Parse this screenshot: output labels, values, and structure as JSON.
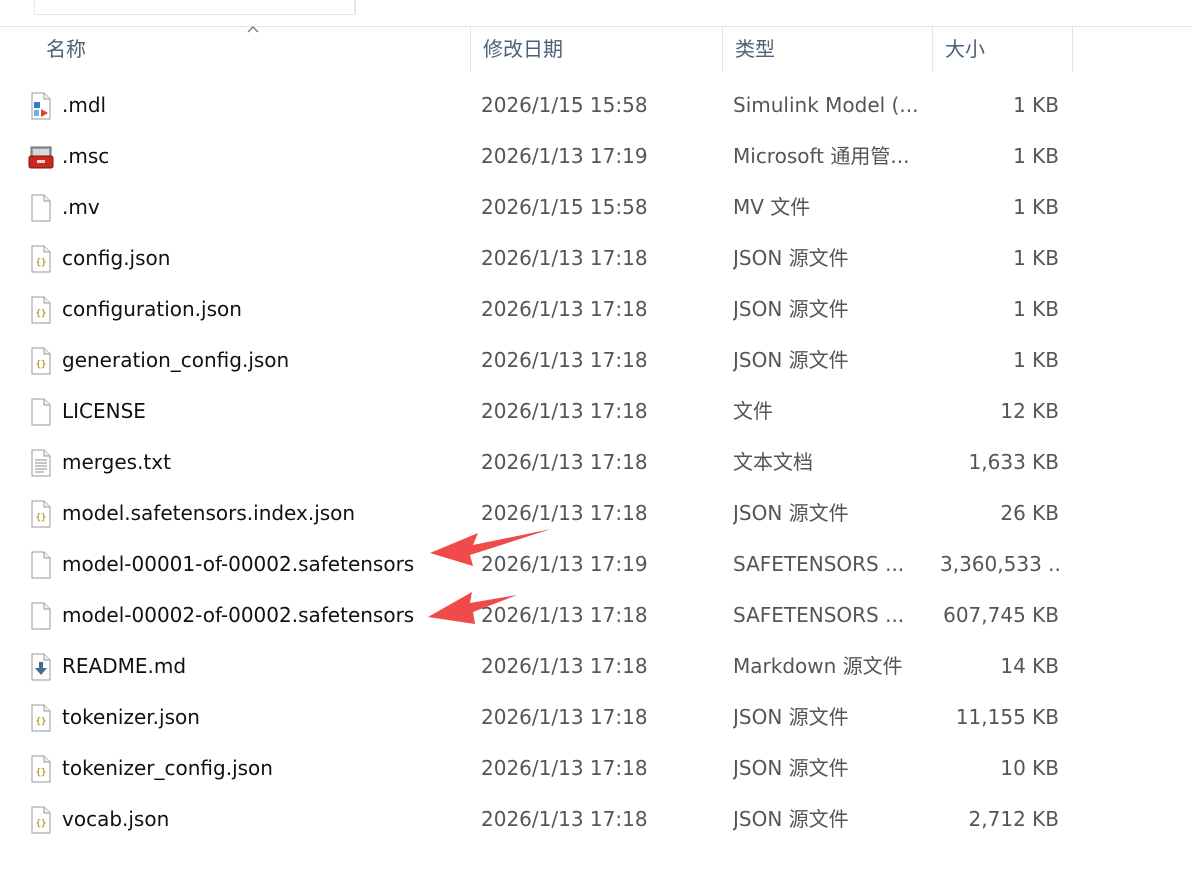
{
  "columns": {
    "name": "名称",
    "date": "修改日期",
    "type": "类型",
    "size": "大小"
  },
  "files": [
    {
      "icon": "simulink-model-icon",
      "name": ".mdl",
      "date": "2026/1/15 15:58",
      "type": "Simulink Model (...",
      "size": "1 KB"
    },
    {
      "icon": "management-console-icon",
      "name": ".msc",
      "date": "2026/1/13 17:19",
      "type": "Microsoft 通用管...",
      "size": "1 KB"
    },
    {
      "icon": "blank-file-icon",
      "name": ".mv",
      "date": "2026/1/15 15:58",
      "type": "MV 文件",
      "size": "1 KB"
    },
    {
      "icon": "json-file-icon",
      "name": "config.json",
      "date": "2026/1/13 17:18",
      "type": "JSON 源文件",
      "size": "1 KB"
    },
    {
      "icon": "json-file-icon",
      "name": "configuration.json",
      "date": "2026/1/13 17:18",
      "type": "JSON 源文件",
      "size": "1 KB"
    },
    {
      "icon": "json-file-icon",
      "name": "generation_config.json",
      "date": "2026/1/13 17:18",
      "type": "JSON 源文件",
      "size": "1 KB"
    },
    {
      "icon": "blank-file-icon",
      "name": "LICENSE",
      "date": "2026/1/13 17:18",
      "type": "文件",
      "size": "12 KB"
    },
    {
      "icon": "text-file-icon",
      "name": "merges.txt",
      "date": "2026/1/13 17:18",
      "type": "文本文档",
      "size": "1,633 KB"
    },
    {
      "icon": "json-file-icon",
      "name": "model.safetensors.index.json",
      "date": "2026/1/13 17:18",
      "type": "JSON 源文件",
      "size": "26 KB"
    },
    {
      "icon": "blank-file-icon",
      "name": "model-00001-of-00002.safetensors",
      "date": "2026/1/13 17:19",
      "type": "SAFETENSORS ...",
      "size": "3,360,533 ..."
    },
    {
      "icon": "blank-file-icon",
      "name": "model-00002-of-00002.safetensors",
      "date": "2026/1/13 17:18",
      "type": "SAFETENSORS ...",
      "size": "607,745 KB"
    },
    {
      "icon": "markdown-file-icon",
      "name": "README.md",
      "date": "2026/1/13 17:18",
      "type": "Markdown 源文件",
      "size": "14 KB"
    },
    {
      "icon": "json-file-icon",
      "name": "tokenizer.json",
      "date": "2026/1/13 17:18",
      "type": "JSON 源文件",
      "size": "11,155 KB"
    },
    {
      "icon": "json-file-icon",
      "name": "tokenizer_config.json",
      "date": "2026/1/13 17:18",
      "type": "JSON 源文件",
      "size": "10 KB"
    },
    {
      "icon": "json-file-icon",
      "name": "vocab.json",
      "date": "2026/1/13 17:18",
      "type": "JSON 源文件",
      "size": "2,712 KB"
    }
  ],
  "annotation_color": "#f04a4a"
}
